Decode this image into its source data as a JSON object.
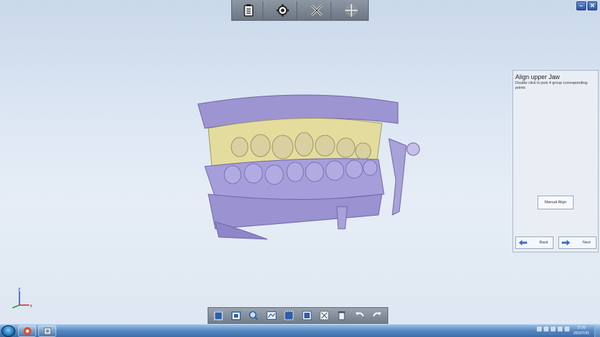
{
  "toolbar_top": {
    "buttons": [
      {
        "icon": "clipboard-icon"
      },
      {
        "icon": "settings-gear-icon"
      },
      {
        "icon": "tools-icon"
      },
      {
        "icon": "crosshair-icon"
      }
    ]
  },
  "window": {
    "minimize_label": "–",
    "close_label": "✕"
  },
  "align_panel": {
    "title": "Align upper Jaw",
    "description": "Double click to pick 4 group corresponding points",
    "manual_align_label": "Manual Align",
    "back_label": "Back",
    "next_label": "Next"
  },
  "toolbar_bottom": {
    "buttons": [
      {
        "icon": "view-cube-icon"
      },
      {
        "icon": "view-front-icon"
      },
      {
        "icon": "zoom-icon"
      },
      {
        "icon": "fit-view-icon"
      },
      {
        "icon": "select-box-icon"
      },
      {
        "icon": "select-all-icon"
      },
      {
        "icon": "deselect-icon"
      },
      {
        "icon": "delete-icon"
      },
      {
        "icon": "undo-icon"
      },
      {
        "icon": "redo-icon"
      }
    ]
  },
  "axis": {
    "x_label": "x",
    "z_label": "z"
  },
  "taskbar": {
    "time": "17:20",
    "date": "2015/7/30"
  },
  "colors": {
    "model_purple": "#9d94d2",
    "model_yellow": "#e3dc9c",
    "accent_blue": "#3d6ec4"
  }
}
